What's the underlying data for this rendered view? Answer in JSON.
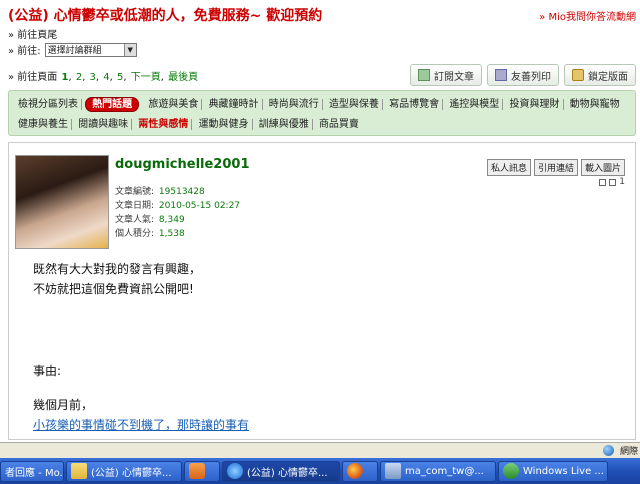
{
  "header": {
    "title": "(公益) 心情鬱卒或低潮的人，免費服務~ 歡迎預約",
    "top_link": "» Mio我問你答流動網"
  },
  "nav": {
    "home": "» 前往頁尾",
    "goto_label": "» 前往:",
    "goto_select": "選擇討論群組",
    "pager_label": "» 前往頁面",
    "pages": [
      "1",
      "2",
      "3",
      "4",
      "5"
    ],
    "pager_next": "下一頁",
    "pager_last": "最後頁"
  },
  "toolbar": {
    "subscribe": "訂閱文章",
    "print": "友善列印",
    "lock": "鎖定版面"
  },
  "categories": {
    "items": [
      "檢視分區列表",
      "熱門話題",
      "旅遊與美食",
      "典藏鐘時計",
      "時尚與流行",
      "造型與保養",
      "寫品博覽會",
      "遙控與模型",
      "投資與理財",
      "動物與寵物",
      "健康與養生",
      "閱讀與趣味",
      "兩性與感情",
      "運動與健身",
      "訓練與優雅",
      "商品買賣"
    ],
    "active": "兩性與感情",
    "hot_badge": "熱門話題"
  },
  "post": {
    "author": "dougmichelle2001",
    "meta": {
      "id_label": "文章編號:",
      "id_value": "19513428",
      "date_label": "文章日期:",
      "date_value": "2010-05-15 02:27",
      "views_label": "文章人氣:",
      "views_value": "8,349",
      "points_label": "個人積分:",
      "points_value": "1,538"
    },
    "buttons": {
      "pm": "私人訊息",
      "quote": "引用連結",
      "download": "載入圖片"
    },
    "floor": "1",
    "body": {
      "line1": "既然有大大對我的發言有興趣，",
      "line2": "不妨就把這個免費資訊公開吧!",
      "line3": "事由:",
      "line4": "幾個月前，",
      "line5": "小孩樂的事情碰不到機了，那時讓的事有"
    }
  },
  "statusbar": {
    "zone": "網際"
  },
  "taskbar": {
    "items": [
      "者回應 - Mo...",
      "(公益) 心情鬱卒...",
      "",
      "(公益) 心情鬱卒...",
      "",
      "ma_com_tw@...",
      "Windows Live ..."
    ]
  }
}
